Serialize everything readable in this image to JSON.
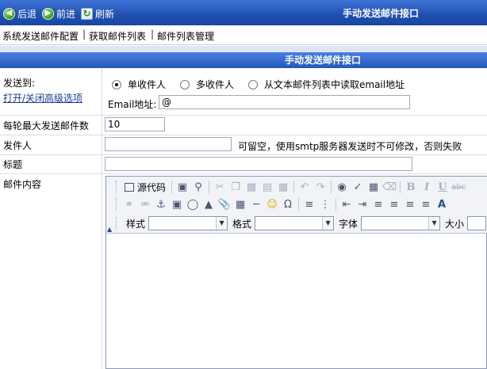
{
  "nav": {
    "back": {
      "label": "后退",
      "icon": "back-arrow-icon"
    },
    "forward": {
      "label": "前进",
      "icon": "forward-arrow-icon"
    },
    "refresh": {
      "label": "刷新",
      "icon": "refresh-icon"
    },
    "title": "手动发送邮件接口"
  },
  "menu": {
    "items": [
      "系统发送邮件配置",
      "获取邮件列表",
      "邮件列表管理"
    ],
    "separator": "|"
  },
  "section": {
    "title": "手动发送邮件接口"
  },
  "form": {
    "send_to_label": "发送到:",
    "toggle_advanced": "打开/关闭高级选项",
    "radio_options": [
      "单收件人",
      "多收件人",
      "从文本邮件列表中读取email地址"
    ],
    "radio_selected": 0,
    "email_label": "Email地址:",
    "email_value": "@",
    "max_per_round_label": "每轮最大发送邮件数",
    "max_per_round_value": "10",
    "sender_label": "发件人",
    "sender_value": "",
    "sender_hint": "可留空，使用smtp服务器发送时不可修改，否则失败",
    "subject_label": "标题",
    "subject_value": "",
    "content_label": "邮件内容"
  },
  "editor": {
    "source_label": "源代码",
    "style_label": "样式",
    "format_label": "格式",
    "font_label": "字体",
    "size_label": "大小",
    "style_value": "",
    "format_value": "",
    "font_value": "",
    "size_value": ""
  },
  "colors": {
    "header_blue": "#2457b8",
    "link": "#1a3a9a"
  }
}
